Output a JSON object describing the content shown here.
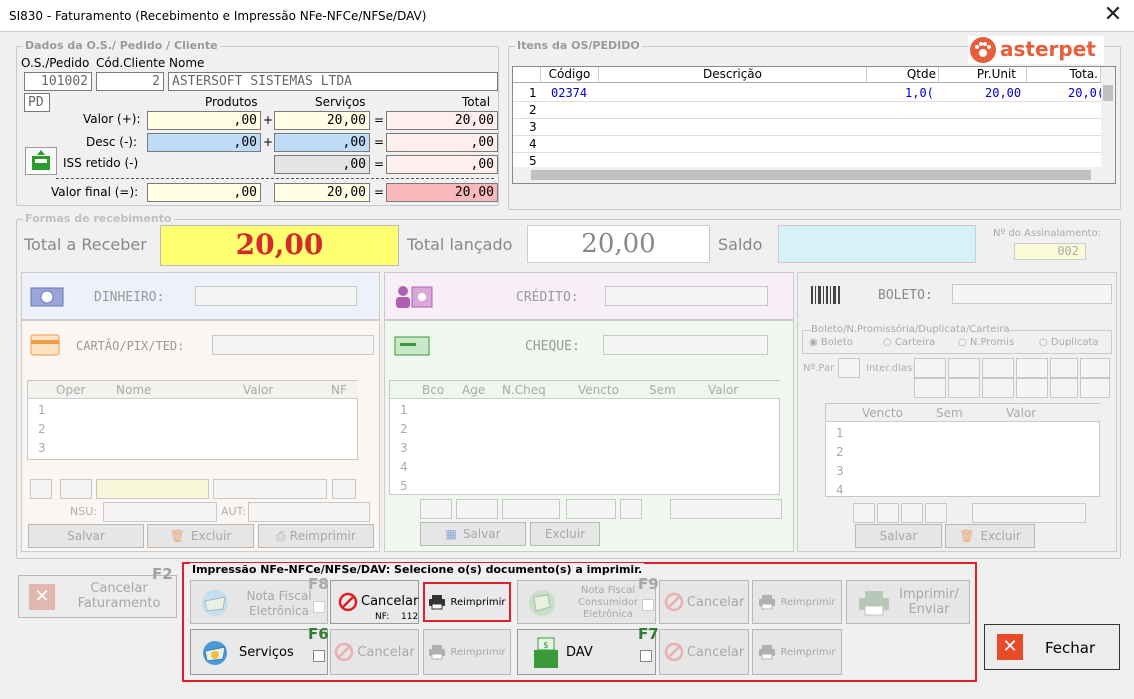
{
  "window": {
    "title": "SI830 - Faturamento (Recebimento e Impressão NFe-NFCe/NFSe/DAV)",
    "close_glyph": "✕"
  },
  "logo": {
    "text": "asterpet"
  },
  "dados": {
    "legend": "Dados da O.S./ Pedido / Cliente",
    "col_os": "O.S./Pedido",
    "col_cod": "Cód.Cliente",
    "col_nome": "Nome",
    "os_value": "101002",
    "cod_value": "2",
    "nome_value": "ASTERSOFT SISTEMAS LTDA",
    "tipo_value": "PD",
    "h_produtos": "Produtos",
    "h_servicos": "Serviços",
    "h_total": "Total",
    "valor_label": "Valor (+):",
    "desc_label": "Desc (-):",
    "iss_label": "ISS retido (-)",
    "final_label": "Valor final (=):",
    "plus": "+",
    "eq": "=",
    "valor": {
      "produtos": ",00",
      "servicos": "20,00",
      "total": "20,00"
    },
    "desc": {
      "produtos": ",00",
      "servicos": ",00",
      "total": ",00"
    },
    "iss": {
      "servicos": ",00",
      "total": ",00"
    },
    "final": {
      "produtos": ",00",
      "servicos": "20,00",
      "total": "20,00"
    }
  },
  "itens": {
    "legend": "Itens da OS/PEDIDO",
    "headers": [
      "Código",
      "Descrição",
      "Qtde",
      "Pr.Unit",
      "Tota."
    ],
    "rows": [
      {
        "n": "1",
        "codigo": "02374",
        "descricao": "",
        "qtde": "1,0(",
        "prunit": "20,00",
        "total": "20,0("
      },
      {
        "n": "2"
      },
      {
        "n": "3"
      },
      {
        "n": "4"
      },
      {
        "n": "5"
      }
    ]
  },
  "formas": {
    "legend": "Formas de recebimento",
    "total_receber_label": "Total a Receber",
    "total_receber": "20,00",
    "total_lancado_label": "Total lançado",
    "total_lancado": "20,00",
    "saldo_label": "Saldo",
    "assinalamento_label": "Nº do Assinalamento:",
    "assinalamento": "002",
    "dinheiro": "DINHEIRO:",
    "cartao": "CARTÃO/PIX/TED:",
    "credito": "CRÉDITO:",
    "cheque": "CHEQUE:",
    "boleto": "BOLETO:",
    "op_headers": [
      "Oper",
      "Nome",
      "Valor",
      "NF"
    ],
    "op_rows": [
      "1",
      "2",
      "3"
    ],
    "nsu": "NSU:",
    "aut": "AUT:",
    "salvar": "Salvar",
    "excluir": "Excluir",
    "reimprimir": "Reimprimir",
    "ch_headers": [
      "Bco",
      "Age",
      "N.Cheq",
      "Vencto",
      "Sem",
      "Valor"
    ],
    "ch_rows": [
      "1",
      "2",
      "3",
      "4",
      "5"
    ],
    "bol_legend": "Boleto/N.Promissória/Duplicata/Carteira",
    "bol_opts": [
      "Boleto",
      "Carteira",
      "N.Promis",
      "Duplicata"
    ],
    "npar": "Nº.Par",
    "interdias": "Inter.dias:",
    "bv_headers": [
      "Vencto",
      "Sem",
      "Valor"
    ],
    "bv_rows": [
      "1",
      "2",
      "3",
      "4"
    ]
  },
  "print": {
    "legend": "Impressão NFe-NFCe/NFSe/DAV: Selecione o(s) documento(s) a imprimir.",
    "cancelar_fat": "Cancelar\nFaturamento",
    "f2": "F2",
    "nfe": "Nota Fiscal\nEletrônica",
    "f8": "F8",
    "cancelar": "Cancelar",
    "nf_label": "NF:",
    "nf_num": "112",
    "reimprimir": "Reimprimir",
    "nfce": "Nota Fiscal\nConsumidor\nEletrônica",
    "f9": "F9",
    "imprimir_enviar": "Imprimir/\nEnviar",
    "servicos": "Serviços",
    "f6": "F6",
    "dav": "DAV",
    "f7": "F7",
    "fechar": "Fechar"
  }
}
